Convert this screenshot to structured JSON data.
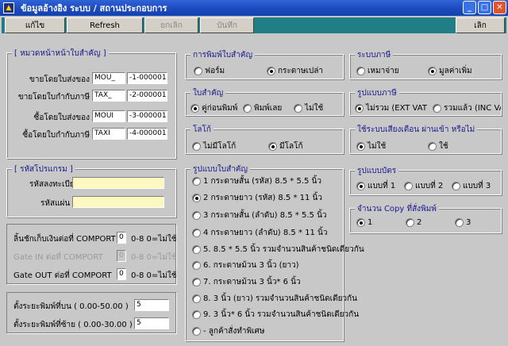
{
  "window": {
    "title": "ข้อมูลอ้างอิง ระบบ / สถานประกอบการ",
    "minimize": "_",
    "maximize": "□",
    "close": "✕"
  },
  "toolbar": {
    "edit": "แก้ไข",
    "refresh": "Refresh",
    "cancel": "ยกเลิก",
    "save": "บันทึก",
    "exit": "เลิก"
  },
  "prefix_group": {
    "title": "[ หมวดหน้าหน้าใบสำคัญ ]",
    "rows": [
      {
        "label": "ขายโดยใบส่งของ",
        "prefix": "MOU_",
        "number": "-1-000001"
      },
      {
        "label": "ขายโดยใบกำกับภาษี",
        "prefix": "TAX_",
        "number": "-2-000001"
      },
      {
        "label": "ซื้อโดยใบส่งของ",
        "prefix": "MOUI",
        "number": "-3-000001"
      },
      {
        "label": "ซื้อโดยใบกำกับภาษี",
        "prefix": "TAXI",
        "number": "-4-000001"
      }
    ]
  },
  "program_code": {
    "title": "[ รหัสโปรแกรม ]",
    "register_label": "รหัสลงทะเบียน",
    "register_value": "",
    "disk_label": "รหัสแผ่น",
    "disk_value": ""
  },
  "comport": {
    "rows": [
      {
        "label": "ลิ้นชักเก็บเงินต่อที่ COMPORT",
        "value": "0",
        "hint": "0-8   0=ไม่ใช้",
        "disabled": false
      },
      {
        "label": "Gate IN ต่อที่ COMPORT",
        "value": "0",
        "hint": "0-8   0=ไม่ใช้",
        "disabled": true
      },
      {
        "label": "Gate OUT ต่อที่ COMPORT",
        "value": "0",
        "hint": "0-8   0=ไม่ใช้",
        "disabled": false
      }
    ]
  },
  "margins": {
    "top_label": "ตั้งระยะพิมพ์ที่บน  ( 0.00-50.00 )",
    "top_value": "5",
    "left_label": "ตั้งระยะพิมพ์ที่ซ้าย ( 0.00-30.00 )",
    "left_value": "5"
  },
  "print_doc": {
    "title": "การพิมพ์ใบสำคัญ",
    "options": [
      "ฟอร์ม",
      "กระดาษเปล่า"
    ],
    "selected": 1
  },
  "doc_type": {
    "title": "ใบสำคัญ",
    "options": [
      "คู่ก่อนพิมพ์",
      "พิมพ์เลย",
      "ไม่ใช้"
    ],
    "selected": 0
  },
  "logo": {
    "title": "โลโก้",
    "options": [
      "ไม่มีโลโก้",
      "มีโลโก้"
    ],
    "selected": 1
  },
  "doc_format": {
    "title": "รูปแบบใบสำคัญ",
    "options": [
      "1  กระดาษสั้น (รหัส) 8.5 * 5.5 นิ้ว",
      "2  กระดาษยาว (รหัส) 8.5 * 11 นิ้ว",
      "3  กระดาษสั้น (ลำดับ) 8.5 * 5.5 นิ้ว",
      "4  กระดาษยาว (ลำดับ) 8.5 * 11 นิ้ว",
      "5. 8.5 * 5.5 นิ้ว รวมจำนวนสินค้าชนิดเดียวกัน",
      "6. กระดาษม้วน 3 นิ้ว (ยาว)",
      "7. กระดาษม้วน 3 นิ้ว* 6 นิ้ว",
      "8. 3 นิ้ว (ยาว) รวมจำนวนสินค้าชนิดเดียวกัน",
      "9. 3 นิ้ว* 6 นิ้ว รวมจำนวนสินค้าชนิดเดียวกัน",
      "-  ลูกค้าสั่งทำพิเศษ"
    ],
    "selected": 1
  },
  "tax_system": {
    "title": "ระบบภาษี",
    "options": [
      "เหมาจ่าย",
      "มูลค่าเพิ่ม"
    ],
    "selected": 1
  },
  "tax_format": {
    "title": "รูปแบบภาษี",
    "options": [
      "ไม่รวม (EXT VAT",
      "รวมแล้ว (INC VAT"
    ],
    "selected": 0
  },
  "alarm": {
    "title": "ใช้ระบบเสียงเตือน ผ่านเข้า หรือไม่",
    "options": [
      "ไม่ใช้",
      "ใช้"
    ],
    "selected": 0
  },
  "card_format": {
    "title": "รูปแบบบัตร",
    "options": [
      "แบบที่ 1",
      "แบบที่ 2",
      "แบบที่ 3"
    ],
    "selected": 0
  },
  "copy_count": {
    "title": "จำนวน Copy ที่สั่งพิมพ์",
    "options": [
      "1",
      "2",
      "3"
    ],
    "selected": 0
  }
}
